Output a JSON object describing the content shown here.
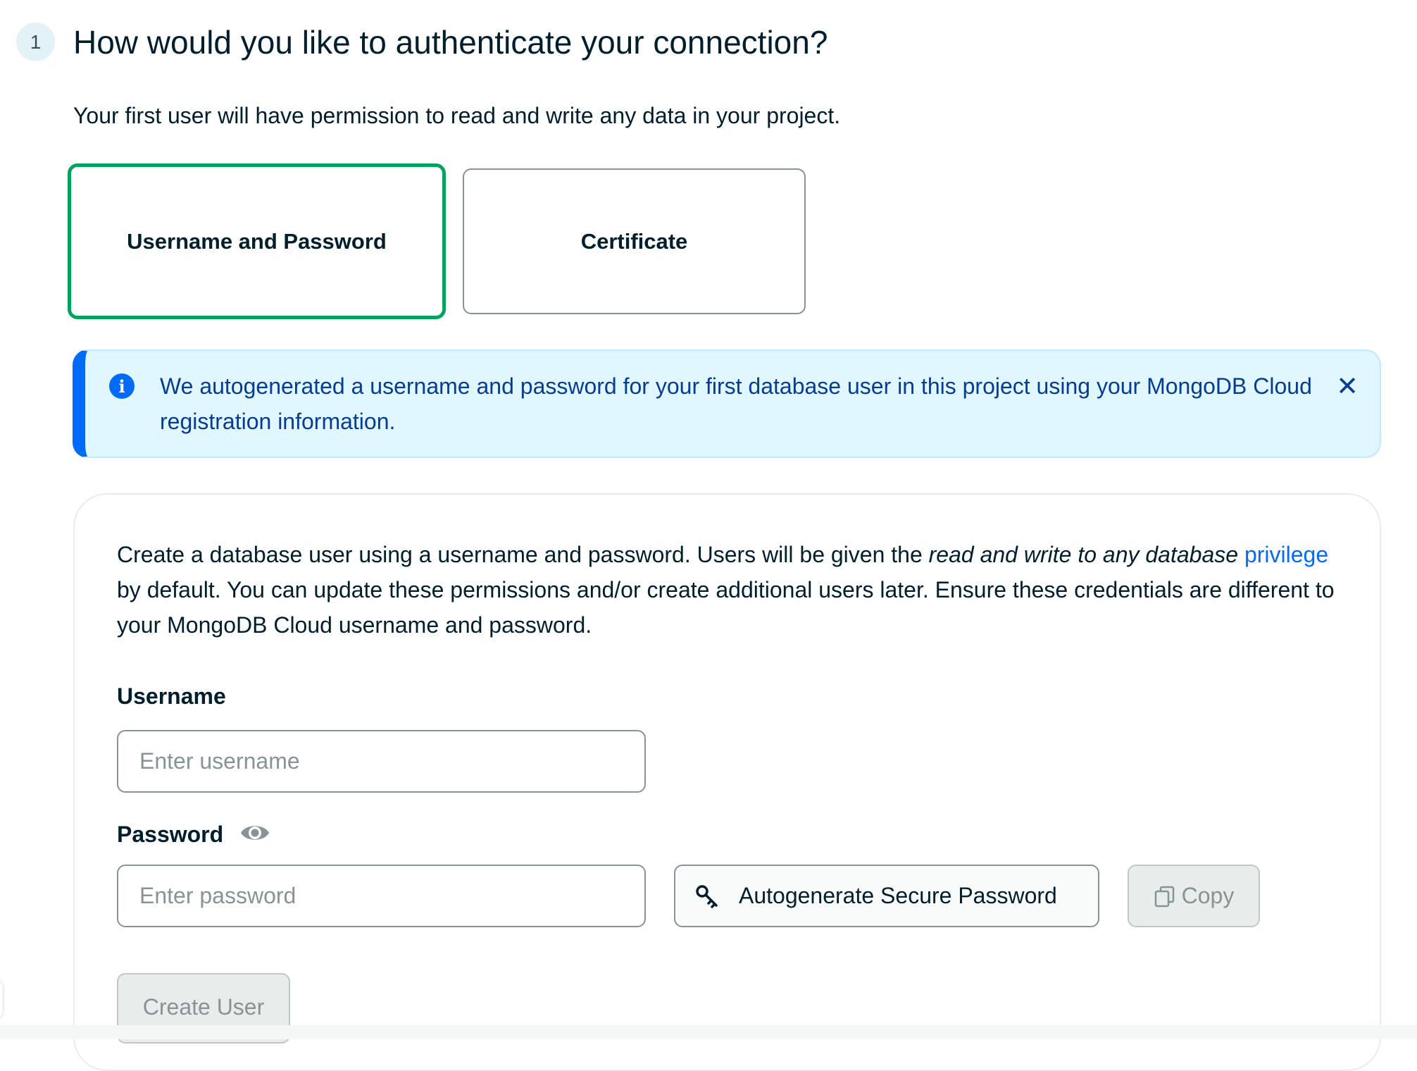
{
  "step": {
    "number": "1",
    "title": "How would you like to authenticate your connection?",
    "subtitle": "Your first user will have permission to read and write any data in your project."
  },
  "auth_methods": [
    {
      "label": "Username and Password",
      "selected": true
    },
    {
      "label": "Certificate",
      "selected": false
    }
  ],
  "info_banner": {
    "icon": "info-icon",
    "text": "We autogenerated a username and password for your first database user in this project using your MongoDB Cloud registration information.",
    "close_icon": "close-icon"
  },
  "form": {
    "description_part1": "Create a database user using a username and password. Users will be given the ",
    "description_italic": "read and write to any database",
    "description_link": "privilege",
    "description_part2": " by default. You can update these permissions and/or create additional users later. Ensure these credentials are different to your MongoDB Cloud username and password.",
    "username": {
      "label": "Username",
      "placeholder": "Enter username",
      "value": ""
    },
    "password": {
      "label": "Password",
      "visibility_icon": "eye-icon",
      "placeholder": "Enter password",
      "value": ""
    },
    "autogenerate_label": "Autogenerate Secure Password",
    "autogenerate_icon": "key-icon",
    "copy_label": "Copy",
    "copy_icon": "copy-icon",
    "create_user_label": "Create User"
  },
  "colors": {
    "selected_border": "#00a35c",
    "info_accent": "#016bf8",
    "info_background": "#e1f7ff",
    "info_text": "#083c90",
    "link": "#016bf8",
    "disabled_text": "#889397"
  }
}
